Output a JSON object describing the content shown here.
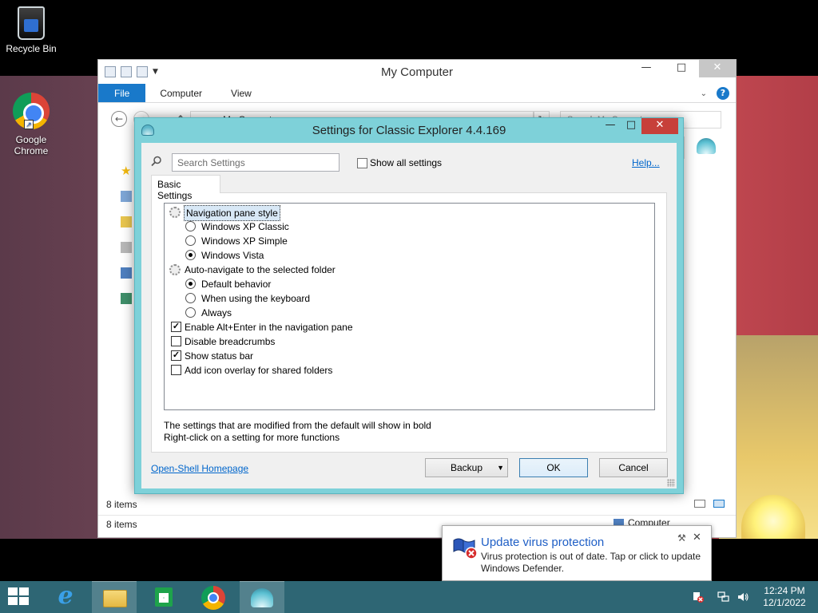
{
  "desktop": {
    "icons": [
      {
        "label": "Recycle Bin"
      },
      {
        "label_line1": "Google",
        "label_line2": "Chrome"
      }
    ]
  },
  "explorer": {
    "title": "My Computer",
    "ribbon_tabs": [
      "File",
      "Computer",
      "View"
    ],
    "address": "My Computer",
    "search_placeholder": "Search My Computer",
    "status_items": "8 items",
    "status_items_bottom": "8 items",
    "status_location": "Computer"
  },
  "dialog": {
    "title": "Settings for Classic Explorer 4.4.169",
    "search_placeholder": "Search Settings",
    "show_all_label": "Show all settings",
    "help_label": "Help...",
    "tab_label": "Basic Settings",
    "tree": [
      {
        "type": "group",
        "label": "Navigation pane style",
        "selected": true
      },
      {
        "type": "radio",
        "label": "Windows XP Classic",
        "checked": false
      },
      {
        "type": "radio",
        "label": "Windows XP Simple",
        "checked": false
      },
      {
        "type": "radio",
        "label": "Windows Vista",
        "checked": true
      },
      {
        "type": "group",
        "label": "Auto-navigate to the selected folder",
        "selected": false
      },
      {
        "type": "radio",
        "label": "Default behavior",
        "checked": true
      },
      {
        "type": "radio",
        "label": "When using the keyboard",
        "checked": false
      },
      {
        "type": "radio",
        "label": "Always",
        "checked": false
      },
      {
        "type": "checkbox",
        "label": "Enable Alt+Enter in the navigation pane",
        "checked": true
      },
      {
        "type": "checkbox",
        "label": "Disable breadcrumbs",
        "checked": false
      },
      {
        "type": "checkbox",
        "label": "Show status bar",
        "checked": true
      },
      {
        "type": "checkbox",
        "label": "Add icon overlay for shared folders",
        "checked": false
      }
    ],
    "note_line1": "The settings that are modified from the default will show in bold",
    "note_line2": "Right-click on a setting for more functions",
    "homepage_link": "Open-Shell Homepage",
    "backup_label": "Backup",
    "ok_label": "OK",
    "cancel_label": "Cancel"
  },
  "notification": {
    "title": "Update virus protection",
    "message": "Virus protection is out of date. Tap or click to update Windows Defender."
  },
  "taskbar": {
    "time": "12:24 PM",
    "date": "12/1/2022"
  },
  "colors": {
    "taskbar": "#2e6674",
    "dialog_frame": "#7ed1d9",
    "link": "#0066cc",
    "file_tab": "#1979ca",
    "close_button": "#c7403a"
  }
}
